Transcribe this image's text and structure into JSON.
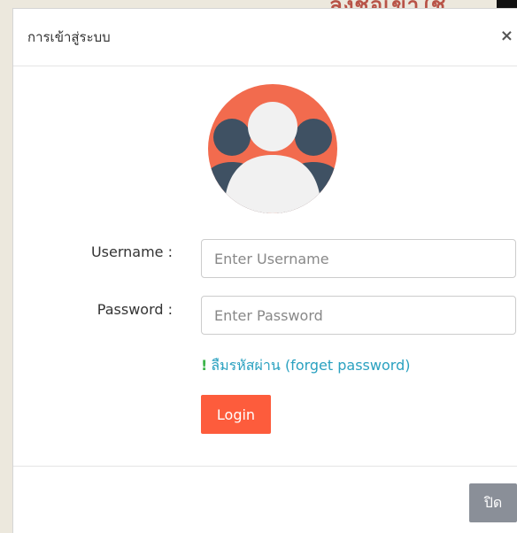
{
  "background": {
    "text": "ลงชื่อเข้าใช้"
  },
  "modal": {
    "title": "การเข้าสู่ระบบ",
    "close_icon": "×",
    "avatar_icon": "users-group-icon",
    "username_label": "Username :",
    "username_placeholder": "Enter Username",
    "password_label": "Password :",
    "password_placeholder": "Enter Password",
    "forget_icon": "!",
    "forget_text": "ลืมรหัสผ่าน (forget password)",
    "login_label": "Login",
    "footer_close_label": "ปิด"
  },
  "colors": {
    "accent": "#fd5c3c",
    "link": "#2aa1c0",
    "footer_button": "#8a8f98",
    "avatar_bg": "#f26b4e",
    "avatar_back": "#3f5163",
    "avatar_front": "#f1f1f1"
  }
}
